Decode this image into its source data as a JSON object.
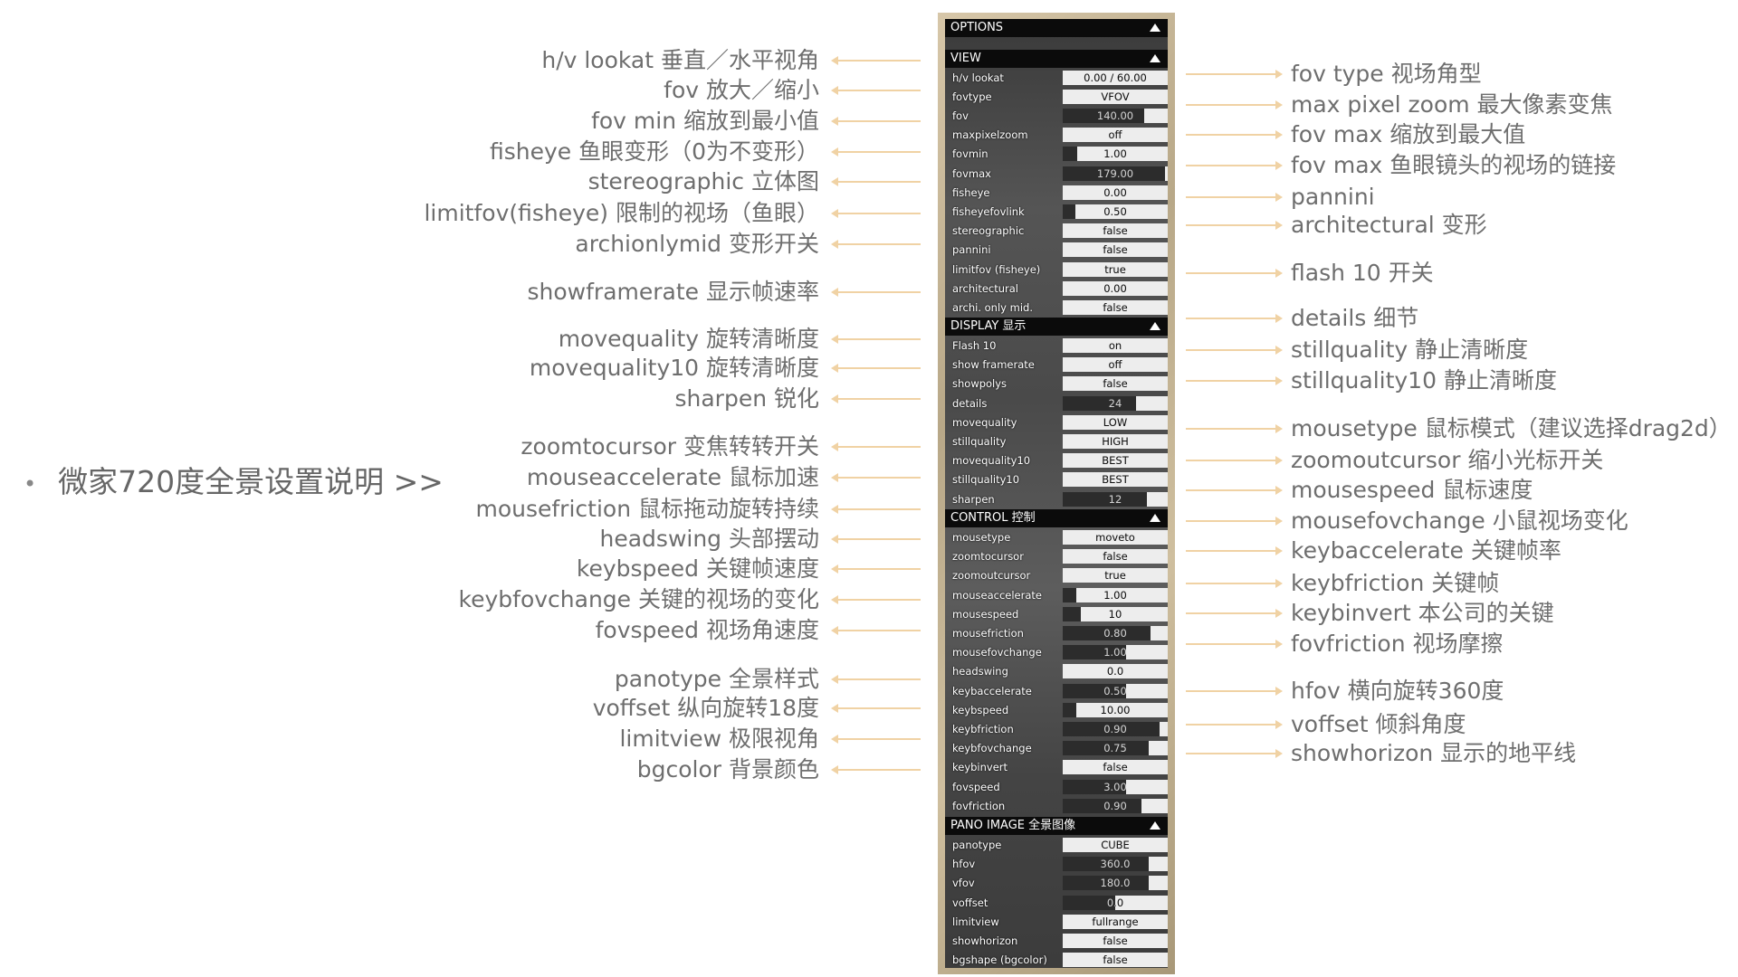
{
  "bullet": "微家720度全景设置说明 >>",
  "panel": {
    "header": "OPTIONS",
    "sections": [
      {
        "header": "VIEW",
        "rows": [
          {
            "label": "h/v lookat",
            "value": "0.00 / 60.00",
            "fill": 0
          },
          {
            "label": "fovtype",
            "value": "VFOV",
            "fill": 0
          },
          {
            "label": "fov",
            "value": "140.00",
            "fill": 0.78
          },
          {
            "label": "maxpixelzoom",
            "value": "off",
            "fill": 0
          },
          {
            "label": "fovmin",
            "value": "1.00",
            "fill": 0.14
          },
          {
            "label": "fovmax",
            "value": "179.00",
            "fill": 0.97
          },
          {
            "label": "fisheye",
            "value": "0.00",
            "fill": 0
          },
          {
            "label": "fisheyefovlink",
            "value": "0.50",
            "fill": 0.12
          },
          {
            "label": "stereographic",
            "value": "false",
            "fill": 0
          },
          {
            "label": "pannini",
            "value": "false",
            "fill": 0
          },
          {
            "label": "limitfov (fisheye)",
            "value": "true",
            "fill": 0
          },
          {
            "label": "architectural",
            "value": "0.00",
            "fill": 0
          },
          {
            "label": "archi. only mid.",
            "value": "false",
            "fill": 0
          }
        ]
      },
      {
        "header": "DISPLAY 显示",
        "rows": [
          {
            "label": "Flash 10",
            "value": "on",
            "fill": 0
          },
          {
            "label": "show framerate",
            "value": "off",
            "fill": 0
          },
          {
            "label": "showpolys",
            "value": "false",
            "fill": 0
          },
          {
            "label": "details",
            "value": "24",
            "fill": 0.7
          },
          {
            "label": "movequality",
            "value": "LOW",
            "fill": 0
          },
          {
            "label": "stillquality",
            "value": "HIGH",
            "fill": 0
          },
          {
            "label": "movequality10",
            "value": "BEST",
            "fill": 0
          },
          {
            "label": "stillquality10",
            "value": "BEST",
            "fill": 0
          },
          {
            "label": "sharpen",
            "value": "12",
            "fill": 0.8
          }
        ]
      },
      {
        "header": "CONTROL 控制",
        "rows": [
          {
            "label": "mousetype",
            "value": "moveto",
            "fill": 0
          },
          {
            "label": "zoomtocursor",
            "value": "false",
            "fill": 0
          },
          {
            "label": "zoomoutcursor",
            "value": "true",
            "fill": 0
          },
          {
            "label": "mouseaccelerate",
            "value": "1.00",
            "fill": 0.13
          },
          {
            "label": "mousespeed",
            "value": "10",
            "fill": 0.17
          },
          {
            "label": "mousefriction",
            "value": "0.80",
            "fill": 0.84
          },
          {
            "label": "mousefovchange",
            "value": "1.00",
            "fill": 0.6
          },
          {
            "label": "headswing",
            "value": "0.0",
            "fill": 0
          },
          {
            "label": "keybaccelerate",
            "value": "0.50",
            "fill": 0.6
          },
          {
            "label": "keybspeed",
            "value": "10.00",
            "fill": 0.13
          },
          {
            "label": "keybfriction",
            "value": "0.90",
            "fill": 0.92
          },
          {
            "label": "keybfovchange",
            "value": "0.75",
            "fill": 0.82
          },
          {
            "label": "keybinvert",
            "value": "false",
            "fill": 0
          },
          {
            "label": "fovspeed",
            "value": "3.00",
            "fill": 0.6
          },
          {
            "label": "fovfriction",
            "value": "0.90",
            "fill": 0.75
          }
        ]
      },
      {
        "header": "PANO IMAGE 全景图像",
        "rows": [
          {
            "label": "panotype",
            "value": "CUBE",
            "fill": 0
          },
          {
            "label": "hfov",
            "value": "360.0",
            "fill": 0.82
          },
          {
            "label": "vfov",
            "value": "180.0",
            "fill": 0.82
          },
          {
            "label": "voffset",
            "value": "0.0",
            "fill": 0.5
          },
          {
            "label": "limitview",
            "value": "fullrange",
            "fill": 0
          },
          {
            "label": "showhorizon",
            "value": "false",
            "fill": 0
          },
          {
            "label": "bgshape (bgcolor)",
            "value": "false",
            "fill": 0
          }
        ]
      }
    ]
  },
  "left_annotations": [
    "h/v lookat 垂直／水平视角",
    "fov 放大／缩小",
    "fov min 缩放到最小值",
    "fisheye 鱼眼变形（0为不变形）",
    "stereographic  立体图",
    "limitfov(fisheye)  限制的视场（鱼眼）",
    "archionlymid  变形开关",
    "showframerate  显示帧速率",
    "movequality  旋转清晰度",
    "movequality10  旋转清晰度",
    "sharpen  锐化",
    "zoomtocursor  变焦转转开关",
    "mouseaccelerate  鼠标加速",
    "mousefriction  鼠标拖动旋转持续",
    "headswing  头部摆动",
    "keybspeed  关键帧速度",
    "keybfovchange  关键的视场的变化",
    "fovspeed  视场角速度",
    "panotype 全景样式",
    "voffset 纵向旋转18度",
    "limitview 极限视角",
    "bgcolor 背景颜色"
  ],
  "right_annotations": [
    "fov type 视场角型",
    "max pixel zoom 最大像素变焦",
    "fov max 缩放到最大值",
    "fov max 鱼眼镜头的视场的链接",
    "pannini",
    "architectural 变形",
    "flash 10 开关",
    "details 细节",
    "stillquality 静止清晰度",
    "stillquality10 静止清晰度",
    "mousetype 鼠标模式（建议选择drag2d）",
    "zoomoutcursor 缩小光标开关",
    "mousespeed 鼠标速度",
    "mousefovchange 小鼠视场变化",
    "keybaccelerate 关键帧率",
    "keybfriction 关键帧",
    "keybinvert 本公司的关键",
    "fovfriction 视场摩擦",
    "hfov 横向旋转360度",
    "voffset 倾斜角度",
    "showhorizon 显示的地平线"
  ]
}
